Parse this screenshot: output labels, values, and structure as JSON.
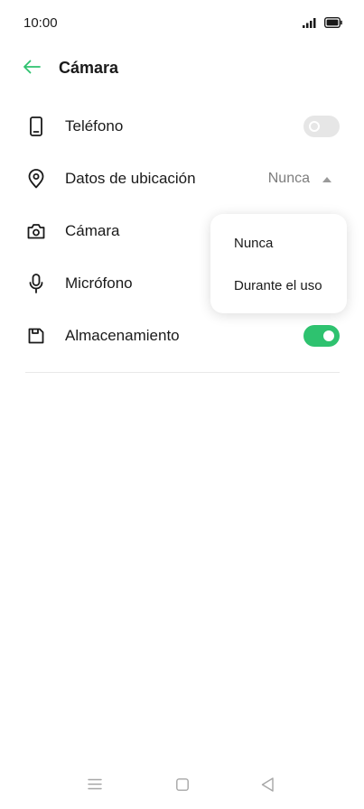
{
  "status_bar": {
    "time": "10:00"
  },
  "header": {
    "title": "Cámara",
    "back_icon": "arrow-left-icon"
  },
  "permissions": [
    {
      "label": "Teléfono",
      "icon": "phone-icon",
      "control": "toggle",
      "enabled": false
    },
    {
      "label": "Datos de ubicación",
      "icon": "location-pin-icon",
      "control": "select",
      "value": "Nunca"
    },
    {
      "label": "Cámara",
      "icon": "camera-icon",
      "control": "none"
    },
    {
      "label": "Micrófono",
      "icon": "microphone-icon",
      "control": "none"
    },
    {
      "label": "Almacenamiento",
      "icon": "storage-icon",
      "control": "toggle",
      "enabled": true
    }
  ],
  "dropdown": {
    "options": [
      "Nunca",
      "Durante el uso"
    ]
  },
  "colors": {
    "accent": "#2ec26f",
    "toggle_off": "#e6e6e6",
    "secondary_text": "#7d7d7d"
  }
}
